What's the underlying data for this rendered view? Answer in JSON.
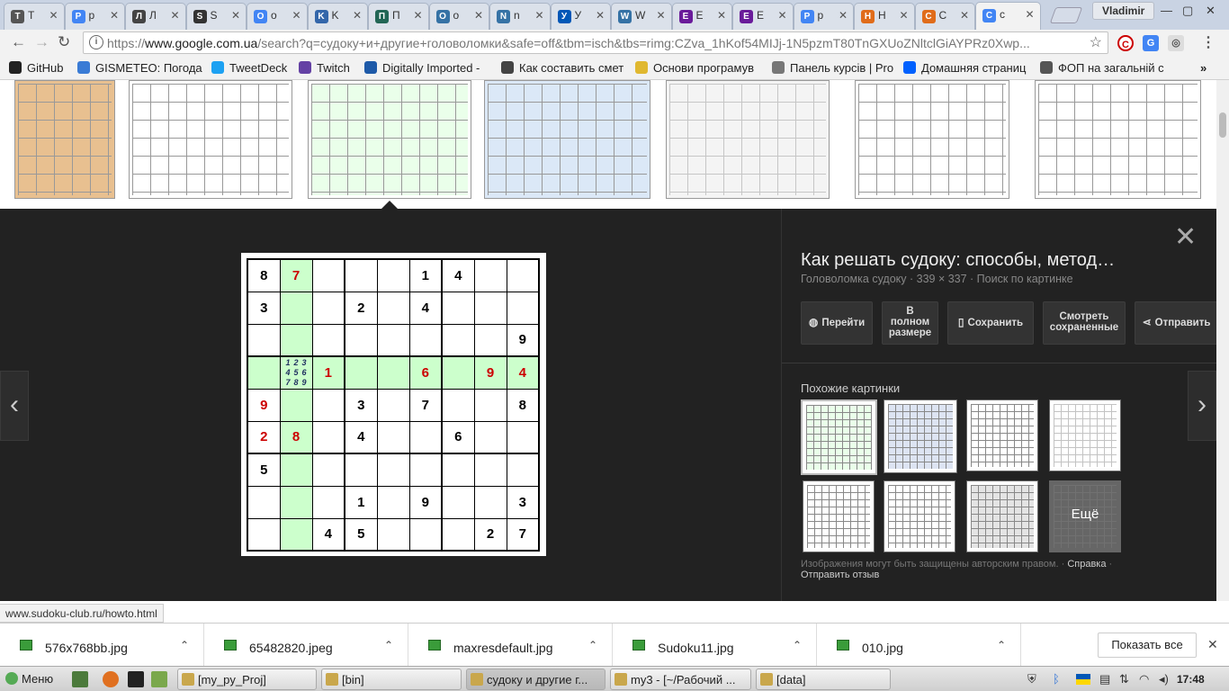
{
  "tabs": [
    {
      "label": "Т",
      "icon": "document-icon",
      "color": "#555555"
    },
    {
      "label": "p",
      "icon": "google-icon",
      "color": "#4285f4"
    },
    {
      "label": "Л",
      "icon": "book-icon",
      "color": "#444444"
    },
    {
      "label": "S",
      "icon": "rc-icon",
      "color": "#333333"
    },
    {
      "label": "o",
      "icon": "google-icon",
      "color": "#4285f4"
    },
    {
      "label": "K",
      "icon": "network-icon",
      "color": "#3366aa"
    },
    {
      "label": "П",
      "icon": "circle-icon",
      "color": "#226655"
    },
    {
      "label": "o",
      "icon": "python-icon",
      "color": "#3572a5"
    },
    {
      "label": "n",
      "icon": "python-icon",
      "color": "#3572a5"
    },
    {
      "label": "У",
      "icon": "ukraine-flag-icon",
      "color": "#0057b7"
    },
    {
      "label": "W",
      "icon": "python-icon",
      "color": "#3572a5"
    },
    {
      "label": "E",
      "icon": "dots-icon",
      "color": "#6a1b9a"
    },
    {
      "label": "E",
      "icon": "dots-icon",
      "color": "#6a1b9a"
    },
    {
      "label": "p",
      "icon": "google-icon",
      "color": "#4285f4"
    },
    {
      "label": "Н",
      "icon": "stack-icon",
      "color": "#e06c1a"
    },
    {
      "label": "С",
      "icon": "stack-icon",
      "color": "#e06c1a"
    },
    {
      "label": "c",
      "icon": "google-icon",
      "color": "#4285f4",
      "active": true
    }
  ],
  "user": "Vladimir",
  "url": {
    "scheme": "https://",
    "host": "www.google.com.ua",
    "path": "/search?q=судоку+и+другие+головоломки&safe=off&tbm=isch&tbs=rimg:CZva_1hKof54MIJj-1N5pzmT80TnGXUoZNltclGiAYPRz0Xwp..."
  },
  "bookmarks": [
    {
      "label": "GitHub",
      "color": "#222222"
    },
    {
      "label": "GISMETEO: Погода",
      "color": "#3a7bd5"
    },
    {
      "label": "TweetDeck",
      "color": "#1da1f2"
    },
    {
      "label": "Twitch",
      "color": "#6441a4"
    },
    {
      "label": "Digitally Imported -",
      "color": "#1e5aa8"
    },
    {
      "label": "Как составить смет",
      "color": "#444444"
    },
    {
      "label": "Основи програмув",
      "color": "#e0b830"
    },
    {
      "label": "Панель курсів | Pro",
      "color": "#777777"
    },
    {
      "label": "Домашняя страниц",
      "color": "#0061fe"
    },
    {
      "label": "ФОП на загальній с",
      "color": "#555555"
    }
  ],
  "viewer": {
    "title": "Как решать судоку: способы, метод…",
    "subtitle": "Головоломка судоку · 339 × 337 · Поиск по картинке",
    "actions": [
      {
        "label": "Перейти",
        "icon": "globe-icon"
      },
      {
        "label": "В полном размере",
        "icon": ""
      },
      {
        "label": "Сохранить",
        "icon": "bookmark-icon"
      },
      {
        "label": "Смотреть сохраненные",
        "icon": ""
      },
      {
        "label": "Отправить",
        "icon": "share-icon"
      }
    ],
    "similar_label": "Похожие картинки",
    "more_label": "Ещё",
    "disclaimer": "Изображения могут быть защищены авторским правом.",
    "help_link": "Справка",
    "feedback_link": "Отправить отзыв"
  },
  "sudoku": {
    "rows": [
      [
        "8",
        "7",
        "",
        "",
        "",
        "1",
        "4",
        "",
        ""
      ],
      [
        "3",
        "",
        "",
        "2",
        "",
        "4",
        "",
        "",
        ""
      ],
      [
        "",
        "",
        "",
        "",
        "",
        "",
        "",
        "",
        "9"
      ],
      [
        "",
        "",
        "1",
        "",
        "",
        "6",
        "",
        "9",
        "4"
      ],
      [
        "9",
        "",
        "",
        "3",
        "",
        "7",
        "",
        "",
        "8"
      ],
      [
        "2",
        "8",
        "",
        "4",
        "",
        "",
        "6",
        "",
        ""
      ],
      [
        "5",
        "",
        "",
        "",
        "",
        "",
        "",
        "",
        ""
      ],
      [
        "",
        "",
        "",
        "1",
        "",
        "9",
        "",
        "",
        "3"
      ],
      [
        "",
        "",
        "4",
        "5",
        "",
        "",
        "",
        "2",
        "7"
      ]
    ],
    "red_cells": [
      "0-1",
      "3-2",
      "3-5",
      "3-7",
      "3-8",
      "4-0",
      "5-0",
      "5-1"
    ],
    "candidates_cell": "3-1",
    "candidates": [
      "1",
      "2",
      "3",
      "4",
      "5",
      "6",
      "7",
      "8",
      "9"
    ]
  },
  "status_url": "www.sudoku-club.ru/howto.html",
  "downloads": [
    {
      "name": "576x768bb.jpg"
    },
    {
      "name": "65482820.jpeg"
    },
    {
      "name": "maxresdefault.jpg"
    },
    {
      "name": "Sudoku11.jpg"
    },
    {
      "name": "010.jpg"
    }
  ],
  "show_all": "Показать все",
  "taskbar": {
    "menu": "Меню",
    "windows": [
      {
        "label": "[my_py_Proj]"
      },
      {
        "label": "[bin]"
      },
      {
        "label": "судоку и другие г...",
        "active": true
      },
      {
        "label": "my3 - [~/Рабочий ..."
      },
      {
        "label": "[data]"
      }
    ],
    "clock": "17:48"
  },
  "colors": {
    "viewer_bg": "#222222",
    "highlight_green": "#ccffcc",
    "given_red": "#cc0000",
    "accent_blue": "#4285f4"
  }
}
